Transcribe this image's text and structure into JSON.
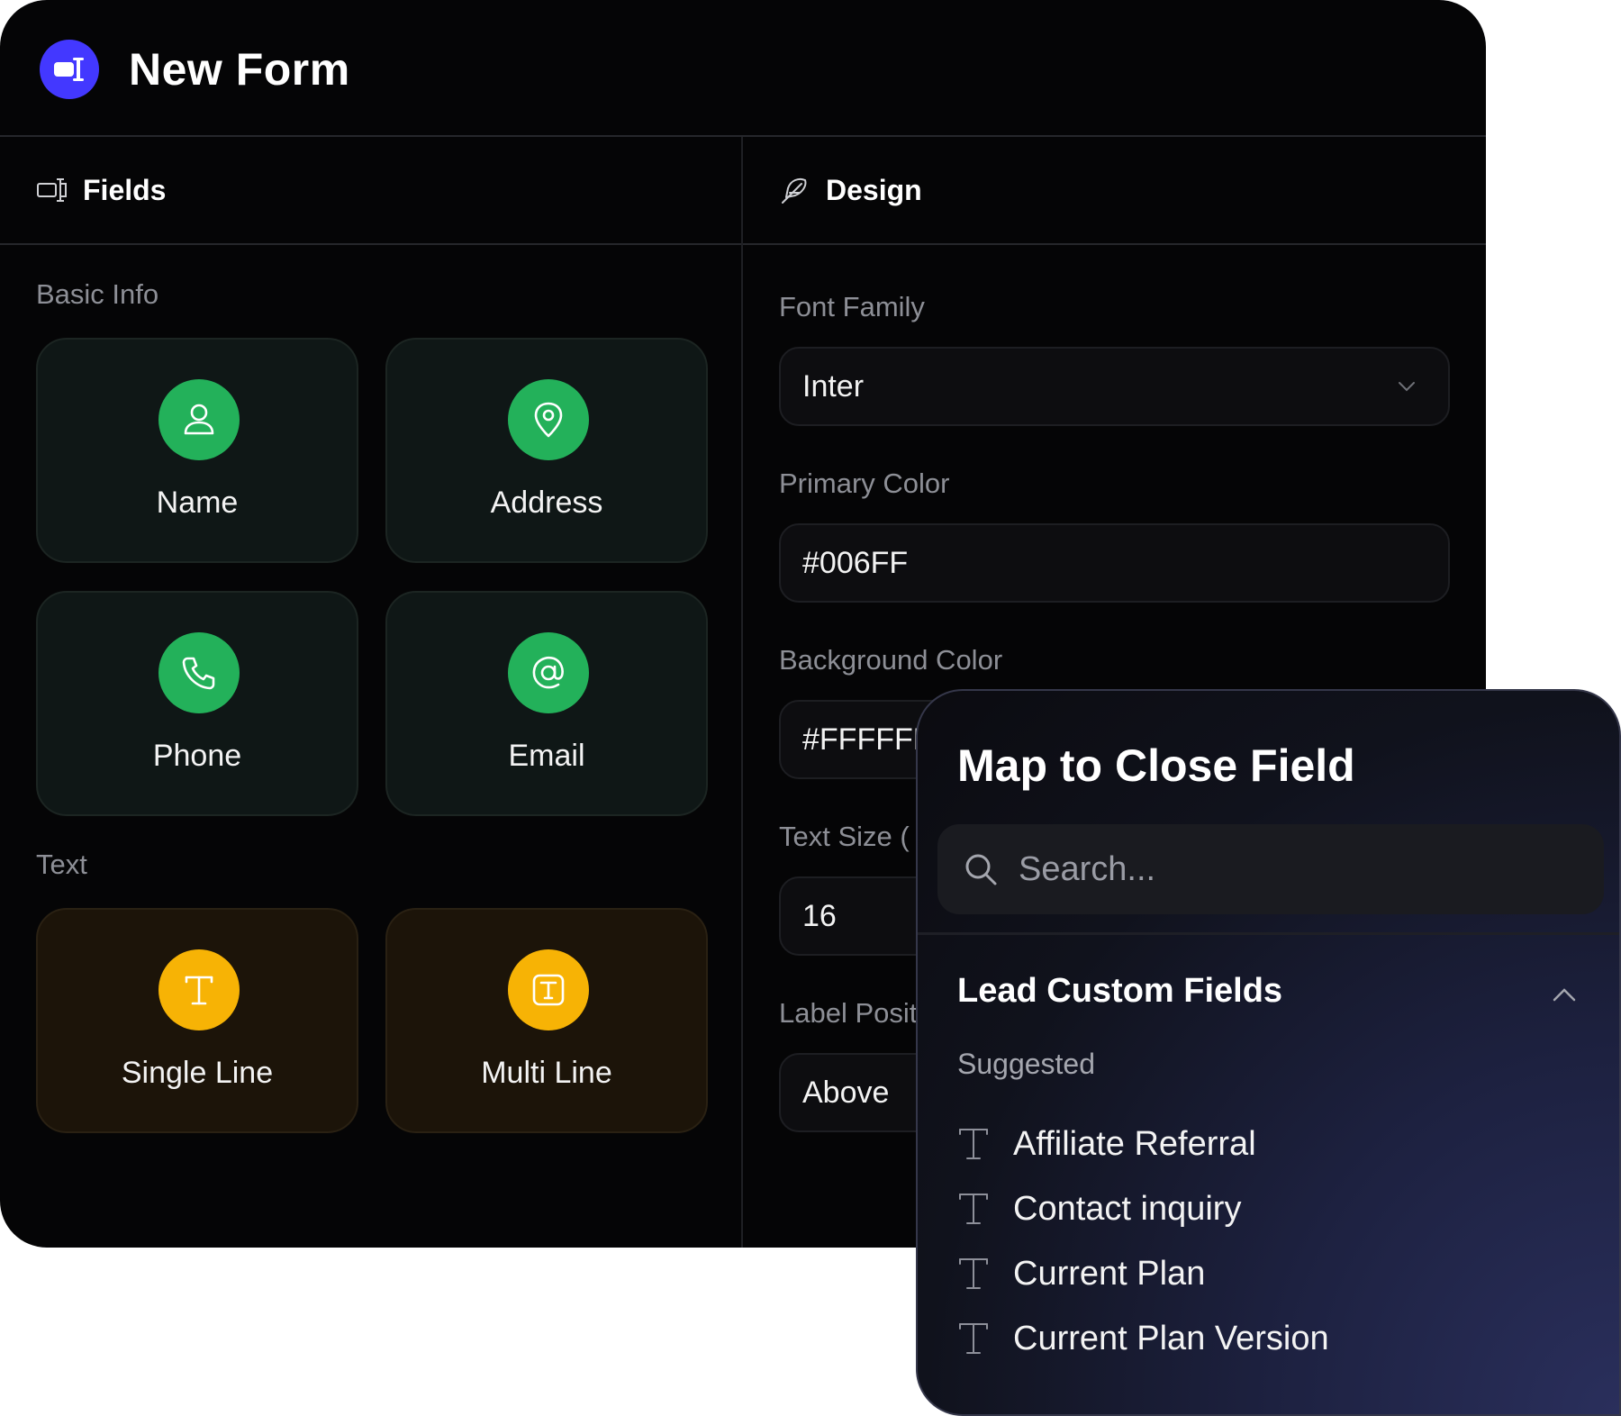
{
  "app": {
    "title": "New Form"
  },
  "tabs": [
    {
      "label": "Fields",
      "icon": "field-icon"
    },
    {
      "label": "Design",
      "icon": "feather-icon"
    }
  ],
  "fields_panel": {
    "sections": [
      {
        "title": "Basic Info",
        "items": [
          {
            "label": "Name",
            "icon": "user-icon",
            "color": "#23b15a"
          },
          {
            "label": "Address",
            "icon": "map-pin-icon",
            "color": "#23b15a"
          },
          {
            "label": "Phone",
            "icon": "phone-icon",
            "color": "#23b15a"
          },
          {
            "label": "Email",
            "icon": "at-sign-icon",
            "color": "#23b15a"
          }
        ]
      },
      {
        "title": "Text",
        "items": [
          {
            "label": "Single Line",
            "icon": "type-icon",
            "color": "#f7b305"
          },
          {
            "label": "Multi Line",
            "icon": "text-box-icon",
            "color": "#f7b305"
          }
        ]
      }
    ]
  },
  "design_panel": {
    "font_family": {
      "label": "Font Family",
      "value": "Inter"
    },
    "primary_color": {
      "label": "Primary Color",
      "value": "#006FF"
    },
    "background_color": {
      "label": "Background Color",
      "value": "#FFFFFF"
    },
    "text_size": {
      "label": "Text Size (",
      "value": "16"
    },
    "label_position": {
      "label": "Label Position",
      "value": "Above"
    }
  },
  "popover": {
    "title": "Map to Close Field",
    "search_placeholder": "Search...",
    "group_title": "Lead Custom Fields",
    "subgroup": "Suggested",
    "options": [
      "Affiliate Referral",
      "Contact inquiry",
      "Current Plan",
      "Current Plan Version"
    ]
  },
  "colors": {
    "accent": "#4338ff",
    "green": "#23b15a",
    "yellow": "#f7b305"
  }
}
